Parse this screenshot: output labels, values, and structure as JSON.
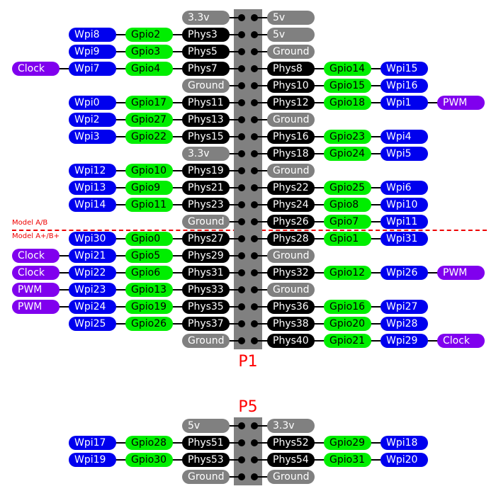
{
  "colors": {
    "power": "#808080",
    "physical": "#000000",
    "gpio": "#00ee00",
    "wiringpi": "#0000ee",
    "function": "#8000ee",
    "header": "#808080",
    "label": "#ff0000"
  },
  "headers": [
    {
      "title": "P1",
      "rows": [
        {
          "left": [
            {
              "t": "3.3v",
              "c": "gray"
            }
          ],
          "right": [
            {
              "t": "5v",
              "c": "gray"
            }
          ]
        },
        {
          "left": [
            {
              "t": "Phys3",
              "c": "black"
            },
            {
              "t": "Gpio2",
              "c": "green"
            },
            {
              "t": "Wpi8",
              "c": "blue"
            }
          ],
          "right": [
            {
              "t": "5v",
              "c": "gray"
            }
          ]
        },
        {
          "left": [
            {
              "t": "Phys5",
              "c": "black"
            },
            {
              "t": "Gpio3",
              "c": "green"
            },
            {
              "t": "Wpi9",
              "c": "blue"
            }
          ],
          "right": [
            {
              "t": "Ground",
              "c": "gray"
            }
          ]
        },
        {
          "left": [
            {
              "t": "Phys7",
              "c": "black"
            },
            {
              "t": "Gpio4",
              "c": "green"
            },
            {
              "t": "Wpi7",
              "c": "blue"
            },
            {
              "t": "Clock",
              "c": "purple"
            }
          ],
          "right": [
            {
              "t": "Phys8",
              "c": "black"
            },
            {
              "t": "Gpio14",
              "c": "green"
            },
            {
              "t": "Wpi15",
              "c": "blue"
            }
          ]
        },
        {
          "left": [
            {
              "t": "Ground",
              "c": "gray"
            }
          ],
          "right": [
            {
              "t": "Phys10",
              "c": "black"
            },
            {
              "t": "Gpio15",
              "c": "green"
            },
            {
              "t": "Wpi16",
              "c": "blue"
            }
          ]
        },
        {
          "left": [
            {
              "t": "Phys11",
              "c": "black"
            },
            {
              "t": "Gpio17",
              "c": "green"
            },
            {
              "t": "Wpi0",
              "c": "blue"
            }
          ],
          "right": [
            {
              "t": "Phys12",
              "c": "black"
            },
            {
              "t": "Gpio18",
              "c": "green"
            },
            {
              "t": "Wpi1",
              "c": "blue"
            },
            {
              "t": "PWM",
              "c": "purple"
            }
          ]
        },
        {
          "left": [
            {
              "t": "Phys13",
              "c": "black"
            },
            {
              "t": "Gpio27",
              "c": "green"
            },
            {
              "t": "Wpi2",
              "c": "blue"
            }
          ],
          "right": [
            {
              "t": "Ground",
              "c": "gray"
            }
          ]
        },
        {
          "left": [
            {
              "t": "Phys15",
              "c": "black"
            },
            {
              "t": "Gpio22",
              "c": "green"
            },
            {
              "t": "Wpi3",
              "c": "blue"
            }
          ],
          "right": [
            {
              "t": "Phys16",
              "c": "black"
            },
            {
              "t": "Gpio23",
              "c": "green"
            },
            {
              "t": "Wpi4",
              "c": "blue"
            }
          ]
        },
        {
          "left": [
            {
              "t": "3.3v",
              "c": "gray"
            }
          ],
          "right": [
            {
              "t": "Phys18",
              "c": "black"
            },
            {
              "t": "Gpio24",
              "c": "green"
            },
            {
              "t": "Wpi5",
              "c": "blue"
            }
          ]
        },
        {
          "left": [
            {
              "t": "Phys19",
              "c": "black"
            },
            {
              "t": "Gpio10",
              "c": "green"
            },
            {
              "t": "Wpi12",
              "c": "blue"
            }
          ],
          "right": [
            {
              "t": "Ground",
              "c": "gray"
            }
          ]
        },
        {
          "left": [
            {
              "t": "Phys21",
              "c": "black"
            },
            {
              "t": "Gpio9",
              "c": "green"
            },
            {
              "t": "Wpi13",
              "c": "blue"
            }
          ],
          "right": [
            {
              "t": "Phys22",
              "c": "black"
            },
            {
              "t": "Gpio25",
              "c": "green"
            },
            {
              "t": "Wpi6",
              "c": "blue"
            }
          ]
        },
        {
          "left": [
            {
              "t": "Phys23",
              "c": "black"
            },
            {
              "t": "Gpio11",
              "c": "green"
            },
            {
              "t": "Wpi14",
              "c": "blue"
            }
          ],
          "right": [
            {
              "t": "Phys24",
              "c": "black"
            },
            {
              "t": "Gpio8",
              "c": "green"
            },
            {
              "t": "Wpi10",
              "c": "blue"
            }
          ]
        },
        {
          "left": [
            {
              "t": "Ground",
              "c": "gray"
            }
          ],
          "right": [
            {
              "t": "Phys26",
              "c": "black"
            },
            {
              "t": "Gpio7",
              "c": "green"
            },
            {
              "t": "Wpi11",
              "c": "blue"
            }
          ]
        },
        {
          "left": [
            {
              "t": "Phys27",
              "c": "black"
            },
            {
              "t": "Gpio0",
              "c": "green"
            },
            {
              "t": "Wpi30",
              "c": "blue"
            }
          ],
          "right": [
            {
              "t": "Phys28",
              "c": "black"
            },
            {
              "t": "Gpio1",
              "c": "green"
            },
            {
              "t": "Wpi31",
              "c": "blue"
            }
          ]
        },
        {
          "left": [
            {
              "t": "Phys29",
              "c": "black"
            },
            {
              "t": "Gpio5",
              "c": "green"
            },
            {
              "t": "Wpi21",
              "c": "blue"
            },
            {
              "t": "Clock",
              "c": "purple"
            }
          ],
          "right": [
            {
              "t": "Ground",
              "c": "gray"
            }
          ]
        },
        {
          "left": [
            {
              "t": "Phys31",
              "c": "black"
            },
            {
              "t": "Gpio6",
              "c": "green"
            },
            {
              "t": "Wpi22",
              "c": "blue"
            },
            {
              "t": "Clock",
              "c": "purple"
            }
          ],
          "right": [
            {
              "t": "Phys32",
              "c": "black"
            },
            {
              "t": "Gpio12",
              "c": "green"
            },
            {
              "t": "Wpi26",
              "c": "blue"
            },
            {
              "t": "PWM",
              "c": "purple"
            }
          ]
        },
        {
          "left": [
            {
              "t": "Phys33",
              "c": "black"
            },
            {
              "t": "Gpio13",
              "c": "green"
            },
            {
              "t": "Wpi23",
              "c": "blue"
            },
            {
              "t": "PWM",
              "c": "purple"
            }
          ],
          "right": [
            {
              "t": "Ground",
              "c": "gray"
            }
          ]
        },
        {
          "left": [
            {
              "t": "Phys35",
              "c": "black"
            },
            {
              "t": "Gpio19",
              "c": "green"
            },
            {
              "t": "Wpi24",
              "c": "blue"
            },
            {
              "t": "PWM",
              "c": "purple"
            }
          ],
          "right": [
            {
              "t": "Phys36",
              "c": "black"
            },
            {
              "t": "Gpio16",
              "c": "green"
            },
            {
              "t": "Wpi27",
              "c": "blue"
            }
          ]
        },
        {
          "left": [
            {
              "t": "Phys37",
              "c": "black"
            },
            {
              "t": "Gpio26",
              "c": "green"
            },
            {
              "t": "Wpi25",
              "c": "blue"
            }
          ],
          "right": [
            {
              "t": "Phys38",
              "c": "black"
            },
            {
              "t": "Gpio20",
              "c": "green"
            },
            {
              "t": "Wpi28",
              "c": "blue"
            }
          ]
        },
        {
          "left": [
            {
              "t": "Ground",
              "c": "gray"
            }
          ],
          "right": [
            {
              "t": "Phys40",
              "c": "black"
            },
            {
              "t": "Gpio21",
              "c": "green"
            },
            {
              "t": "Wpi29",
              "c": "blue"
            },
            {
              "t": "Clock",
              "c": "purple"
            }
          ]
        }
      ]
    },
    {
      "title": "P5",
      "rows": [
        {
          "left": [
            {
              "t": "5v",
              "c": "gray"
            }
          ],
          "right": [
            {
              "t": "3.3v",
              "c": "gray"
            }
          ]
        },
        {
          "left": [
            {
              "t": "Phys51",
              "c": "black"
            },
            {
              "t": "Gpio28",
              "c": "green"
            },
            {
              "t": "Wpi17",
              "c": "blue"
            }
          ],
          "right": [
            {
              "t": "Phys52",
              "c": "black"
            },
            {
              "t": "Gpio29",
              "c": "green"
            },
            {
              "t": "Wpi18",
              "c": "blue"
            }
          ]
        },
        {
          "left": [
            {
              "t": "Phys53",
              "c": "black"
            },
            {
              "t": "Gpio30",
              "c": "green"
            },
            {
              "t": "Wpi19",
              "c": "blue"
            }
          ],
          "right": [
            {
              "t": "Phys54",
              "c": "black"
            },
            {
              "t": "Gpio31",
              "c": "green"
            },
            {
              "t": "Wpi20",
              "c": "blue"
            }
          ]
        },
        {
          "left": [
            {
              "t": "Ground",
              "c": "gray"
            }
          ],
          "right": [
            {
              "t": "Ground",
              "c": "gray"
            }
          ]
        }
      ]
    }
  ],
  "model_divider": {
    "above_label": "Model A/B",
    "below_label": "Model A+/B+"
  }
}
